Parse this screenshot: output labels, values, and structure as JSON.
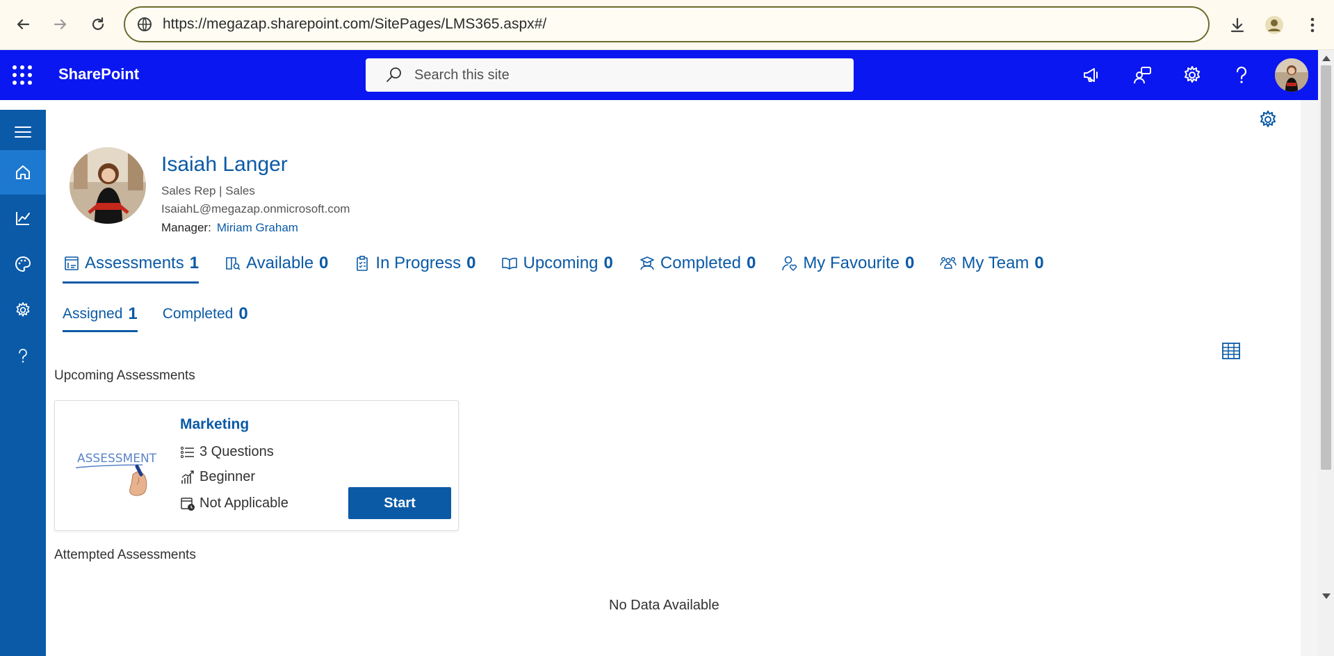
{
  "browser": {
    "url": "https://megazap.sharepoint.com/SitePages/LMS365.aspx#/"
  },
  "header": {
    "brand": "SharePoint",
    "search_placeholder": "Search this site"
  },
  "profile": {
    "name": "Isaiah Langer",
    "title": "Sales Rep | Sales",
    "email": "IsaiahL@megazap.onmicrosoft.com",
    "manager_label": "Manager:",
    "manager_name": "Miriam Graham"
  },
  "tabs": [
    {
      "label": "Assessments",
      "count": "1",
      "icon": "assessment-icon"
    },
    {
      "label": "Available",
      "count": "0",
      "icon": "book-search-icon"
    },
    {
      "label": "In Progress",
      "count": "0",
      "icon": "clipboard-icon"
    },
    {
      "label": "Upcoming",
      "count": "0",
      "icon": "open-book-icon"
    },
    {
      "label": "Completed",
      "count": "0",
      "icon": "graduate-icon"
    },
    {
      "label": "My Favourite",
      "count": "0",
      "icon": "person-heart-icon"
    },
    {
      "label": "My Team",
      "count": "0",
      "icon": "team-icon"
    }
  ],
  "subtabs": [
    {
      "label": "Assigned",
      "count": "1"
    },
    {
      "label": "Completed",
      "count": "0"
    }
  ],
  "sections": {
    "upcoming": "Upcoming Assessments",
    "attempted": "Attempted Assessments",
    "no_data": "No Data Available"
  },
  "card": {
    "thumb_text": "ASSESSMENT",
    "title": "Marketing",
    "questions": "3 Questions",
    "level": "Beginner",
    "due": "Not Applicable",
    "button": "Start"
  },
  "colors": {
    "header_bg": "#0a17f0",
    "rail_bg": "#0a5aa8",
    "accent": "#0b5aa6"
  }
}
